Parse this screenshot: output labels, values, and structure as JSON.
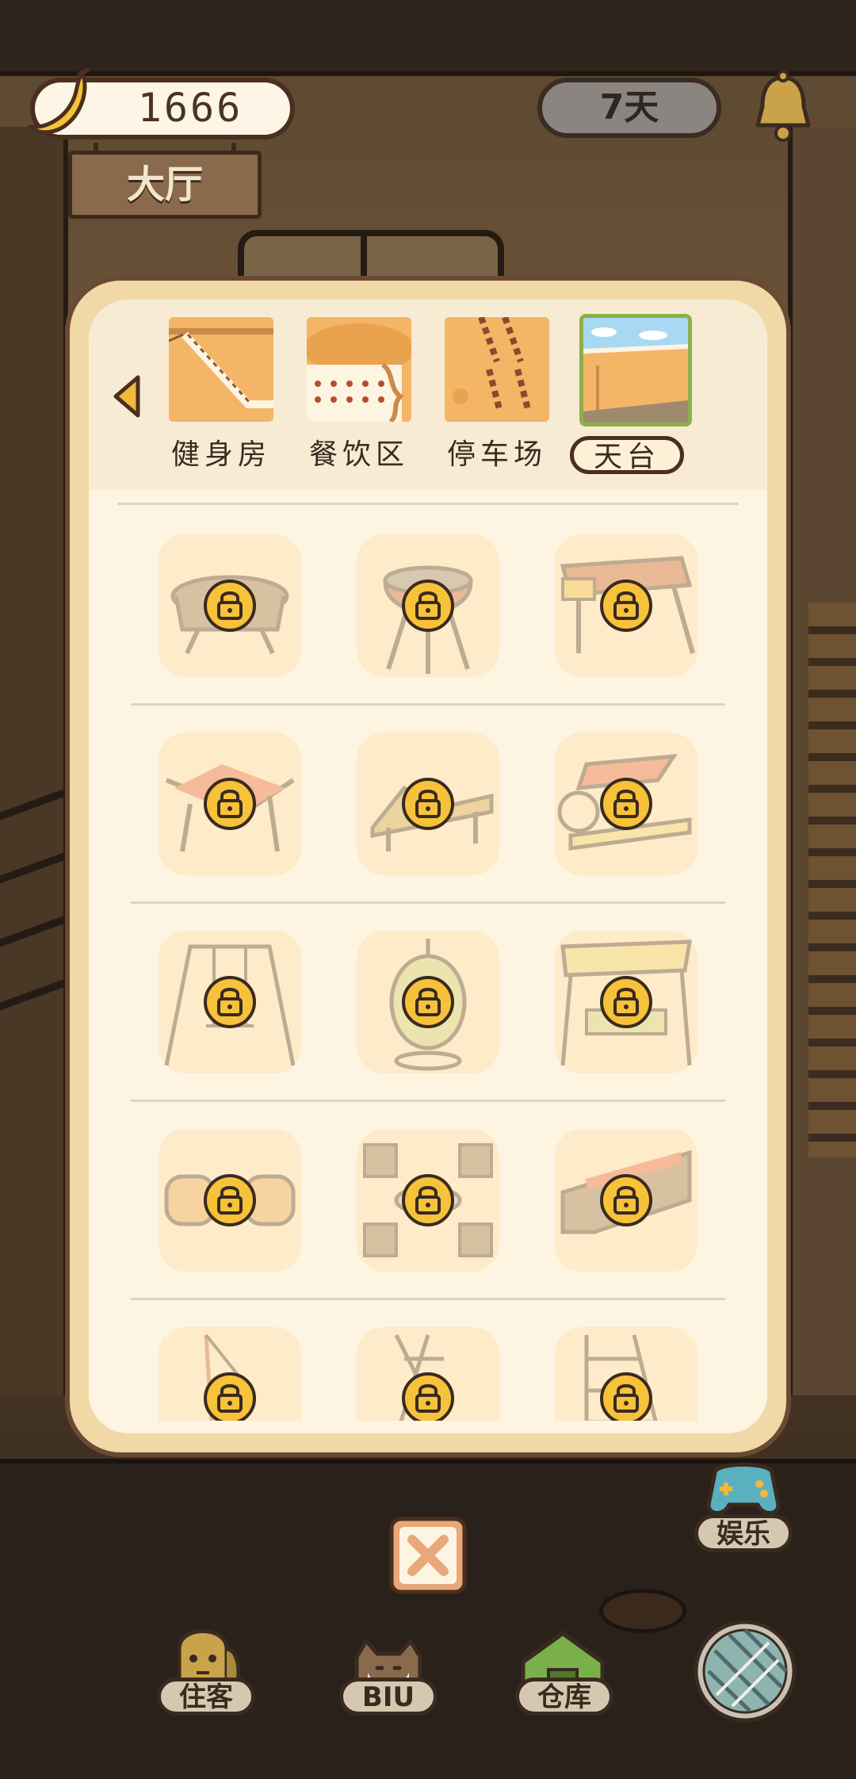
{
  "hud": {
    "banana_icon": "banana-icon",
    "banana_count": "1666",
    "days": "7天",
    "bell_icon": "bell-icon",
    "room_name": "大厅"
  },
  "panel": {
    "prev_icon": "left-arrow-icon",
    "tabs": [
      {
        "label": "健身房",
        "selected": false
      },
      {
        "label": "餐饮区",
        "selected": false
      },
      {
        "label": "停车场",
        "selected": false
      },
      {
        "label": "天台",
        "selected": true
      }
    ],
    "items": [
      {
        "name": "round-grill",
        "locked": true
      },
      {
        "name": "kettle-grill",
        "locked": true
      },
      {
        "name": "bbq-cart-grill",
        "locked": true
      },
      {
        "name": "folding-lounge-chair",
        "locked": true
      },
      {
        "name": "sun-lounger",
        "locked": true
      },
      {
        "name": "canopy-lounger",
        "locked": true
      },
      {
        "name": "swing-set",
        "locked": true
      },
      {
        "name": "egg-hanging-chair",
        "locked": true
      },
      {
        "name": "canopy-swing-bench",
        "locked": true
      },
      {
        "name": "wicker-chair-pair",
        "locked": true
      },
      {
        "name": "patio-table-set",
        "locked": true
      },
      {
        "name": "corner-sofa",
        "locked": true
      },
      {
        "name": "umbrella-stand",
        "locked": true
      },
      {
        "name": "folding-stand",
        "locked": true
      },
      {
        "name": "ladder-rack",
        "locked": true
      }
    ],
    "lock_icon": "lock-icon"
  },
  "bottom": {
    "close_icon": "close-icon",
    "fun_label": "娱乐",
    "nav": [
      {
        "label": "住客",
        "icon": "guest-icon"
      },
      {
        "label": "BIU",
        "icon": "cat-icon"
      },
      {
        "label": "仓库",
        "icon": "warehouse-icon"
      }
    ],
    "yarn_icon": "yarn-ball-icon"
  }
}
